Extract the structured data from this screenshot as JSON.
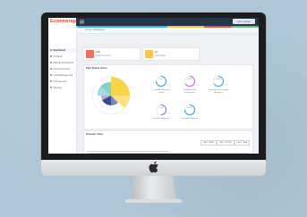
{
  "app": {
    "brand": "Ecommeraps",
    "user_chip": "John Smith"
  },
  "breadcrumb": "Home / Dashboard",
  "sidebar": {
    "items": [
      {
        "label": "Dashboard"
      },
      {
        "label": "Contacts"
      },
      {
        "label": "Partner & Programs"
      },
      {
        "label": "Announcements"
      },
      {
        "label": "Lead Management"
      },
      {
        "label": "Procurement"
      },
      {
        "label": "Settings"
      }
    ]
  },
  "stats": [
    {
      "title": "22%",
      "subtitle": "Linked Accounts",
      "color": "#f26b5b"
    },
    {
      "title": "22",
      "subtitle": "Lead Status",
      "color": "#f6c451"
    }
  ],
  "panel": {
    "title": "Plan Status Score",
    "donuts": [
      {
        "label": "Complete Referral Listing",
        "value": "6/5",
        "color": "#5aa9de",
        "level": 0.75
      },
      {
        "label": "Complete Plan Acceptance",
        "value": "10/15",
        "color": "#c57ad6",
        "level": 0.66
      },
      {
        "label": "Schedule with Training Approval",
        "value": "30/45",
        "color": "#4fb3e3",
        "level": 0.66
      },
      {
        "label": "Schedule Approval",
        "value": "5/10",
        "color": "#9a84d9",
        "level": 0.5
      },
      {
        "label": "Schedule Approval",
        "value": "15/20",
        "color": "#3fb0e0",
        "level": 0.75
      }
    ]
  },
  "bottom_panel": {
    "title": "Previous View",
    "buttons": [
      "LAST WEEK",
      "LAST MONTH",
      "LAST YEAR"
    ]
  },
  "colors": {
    "topbar": "#253547",
    "accent_blue": "#3fb6e8",
    "accent_yellow": "#f5c84a",
    "accent_red": "#e8543c",
    "accent_green": "#6cc080"
  }
}
